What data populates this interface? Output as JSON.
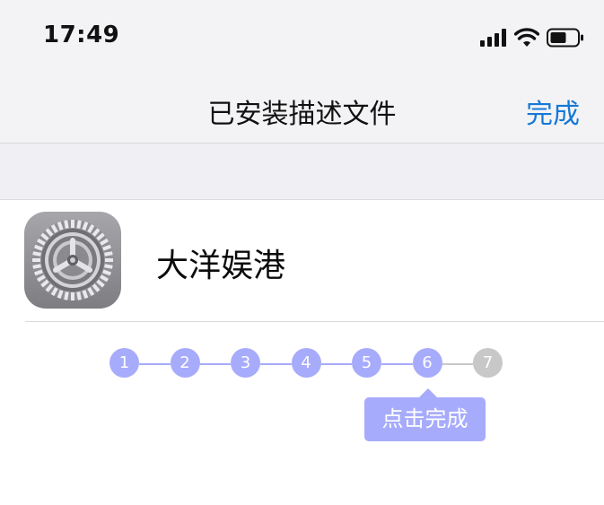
{
  "status_bar": {
    "time": "17:49",
    "icons": [
      "cellular-signal-icon",
      "wifi-icon",
      "battery-icon"
    ]
  },
  "nav": {
    "title": "已安装描述文件",
    "done_label": "完成",
    "done_color": "#1479d6"
  },
  "profile": {
    "name": "大洋娱港",
    "icon": "settings-gear-icon"
  },
  "stepper": {
    "steps": [
      {
        "label": "1",
        "state": "done"
      },
      {
        "label": "2",
        "state": "done"
      },
      {
        "label": "3",
        "state": "done"
      },
      {
        "label": "4",
        "state": "done"
      },
      {
        "label": "5",
        "state": "done"
      },
      {
        "label": "6",
        "state": "current"
      },
      {
        "label": "7",
        "state": "pending"
      }
    ],
    "active_color": "#a7abfb",
    "pending_color": "#c8c8c8"
  },
  "tooltip": {
    "text": "点击完成"
  }
}
